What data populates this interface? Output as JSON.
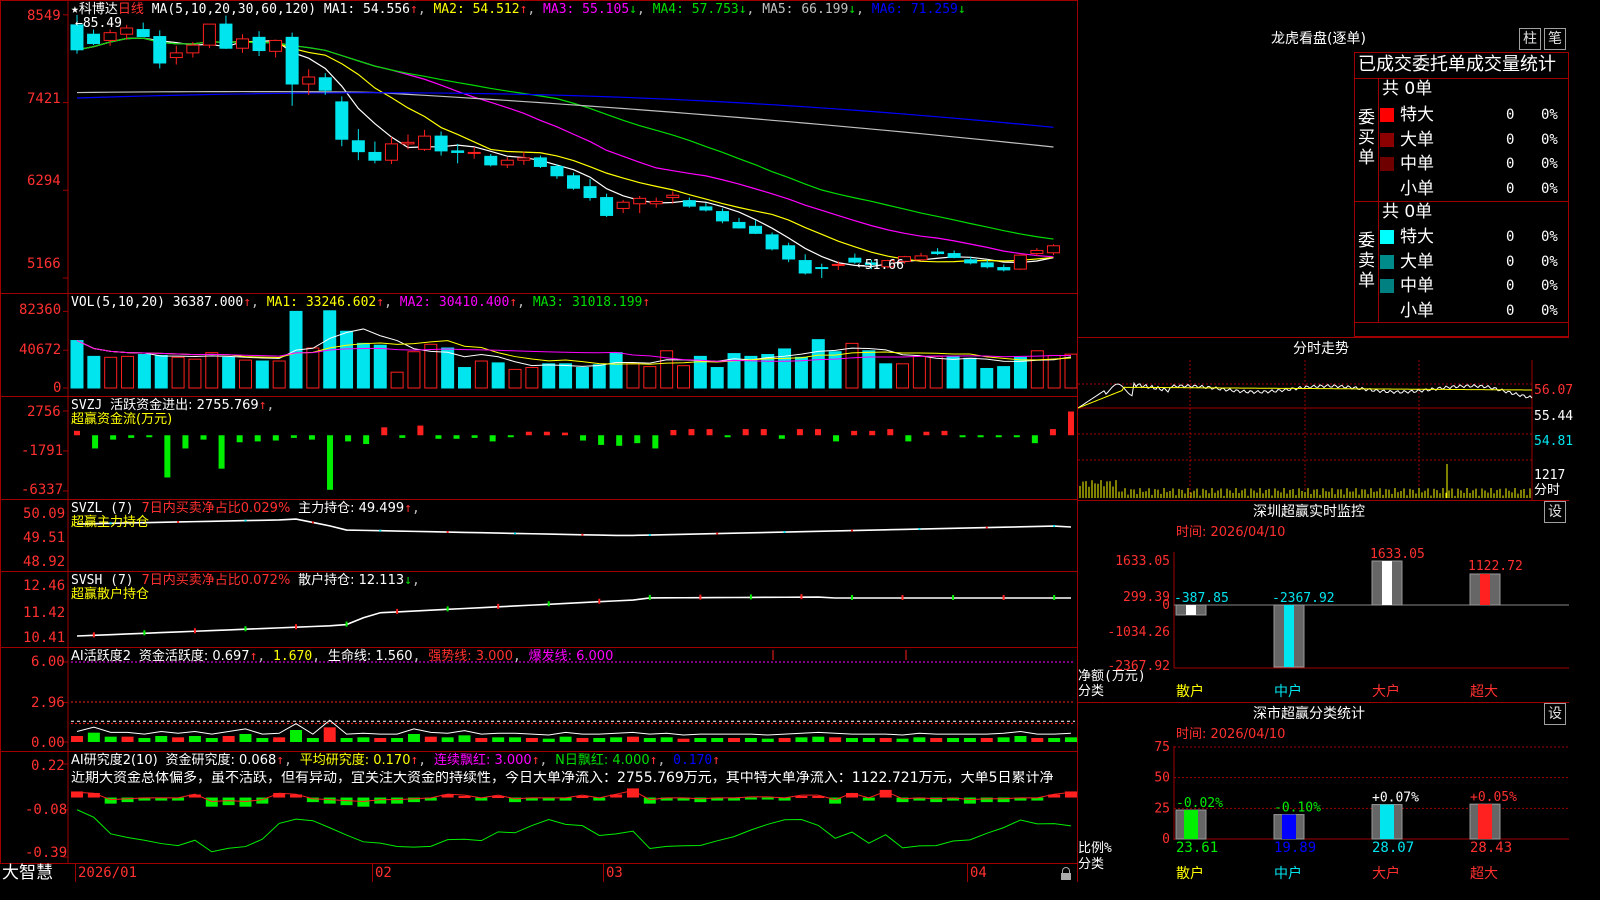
{
  "colors": {
    "up": "#ff2020",
    "down": "#00e5ee",
    "bg": "#000000",
    "grid": "#a00000",
    "axisText": "#ff3030",
    "ma1": "#ffffff",
    "ma2": "#ffff00",
    "ma3": "#ff00ff",
    "ma4": "#00dd00",
    "ma5": "#c0c0c0",
    "ma6": "#0000ff",
    "zoom": "#ffff00"
  },
  "main": {
    "header": {
      "star": "★",
      "name": "科博达",
      "period": "日线",
      "ma_label": "MA(5,10,20,30,60,120)",
      "ma1": "MA1: 54.556",
      "ma2": "MA2: 54.512",
      "ma3": "MA3: 55.105",
      "ma4": "MA4: 57.753",
      "ma5": "MA5: 66.199",
      "ma6": "MA6: 71.259",
      "ma1_arrow": "↑",
      "ma2_arrow": "↑",
      "ma3_arrow": "↓",
      "ma4_arrow": "↓",
      "ma5_arrow": "↓",
      "ma6_arrow": "↓"
    },
    "yticks": [
      {
        "label": "8549",
        "v": 85.49
      },
      {
        "label": "7421",
        "v": 74.21
      },
      {
        "label": "6294",
        "v": 62.94
      },
      {
        "label": "5166",
        "v": 51.66
      }
    ],
    "high_label": "←85.49",
    "low_label": "←51.66"
  },
  "chart_data": [
    {
      "type": "candlestick",
      "name": "科博达 日线",
      "x_labels": [
        "2026/01",
        "02",
        "03",
        "04"
      ],
      "ylim": [
        50.5,
        86.5
      ],
      "ohlc": [
        [
          84.2,
          85.49,
          80.5,
          81.0
        ],
        [
          83.0,
          83.6,
          81.6,
          81.8
        ],
        [
          82.2,
          83.6,
          81.5,
          83.2
        ],
        [
          83.0,
          84.2,
          82.3,
          83.8
        ],
        [
          83.6,
          84.5,
          82.8,
          82.7
        ],
        [
          82.7,
          83.5,
          78.6,
          79.3
        ],
        [
          80.0,
          81.5,
          79.1,
          80.6
        ],
        [
          80.6,
          82.0,
          80.0,
          81.6
        ],
        [
          81.6,
          83.8,
          81.2,
          84.3
        ],
        [
          84.3,
          85.4,
          81.1,
          81.2
        ],
        [
          81.2,
          83.0,
          80.6,
          82.4
        ],
        [
          82.6,
          83.4,
          80.2,
          80.9
        ],
        [
          80.8,
          82.3,
          80.0,
          82.2
        ],
        [
          82.6,
          83.2,
          73.8,
          76.6
        ],
        [
          76.6,
          78.5,
          75.2,
          77.5
        ],
        [
          77.4,
          78.0,
          75.2,
          75.8
        ],
        [
          74.3,
          75.0,
          68.6,
          69.5
        ],
        [
          69.3,
          70.8,
          66.8,
          67.9
        ],
        [
          67.8,
          69.2,
          66.4,
          66.8
        ],
        [
          66.8,
          69.8,
          66.3,
          68.9
        ],
        [
          68.9,
          70.1,
          68.2,
          69.1
        ],
        [
          68.2,
          70.7,
          68.0,
          69.9
        ],
        [
          69.9,
          70.5,
          67.4,
          68.0
        ],
        [
          68.0,
          68.9,
          66.4,
          67.8
        ],
        [
          67.8,
          68.5,
          67.0,
          67.8
        ],
        [
          67.3,
          67.6,
          66.0,
          66.2
        ],
        [
          66.2,
          67.2,
          65.8,
          66.8
        ],
        [
          66.8,
          67.9,
          66.2,
          67.1
        ],
        [
          67.1,
          67.4,
          65.8,
          66.0
        ],
        [
          66.0,
          66.3,
          64.4,
          64.8
        ],
        [
          64.8,
          65.2,
          63.0,
          63.2
        ],
        [
          63.4,
          64.4,
          61.6,
          62.0
        ],
        [
          62.0,
          62.5,
          59.5,
          59.7
        ],
        [
          60.6,
          61.7,
          60.0,
          61.4
        ],
        [
          61.2,
          62.2,
          60.0,
          61.9
        ],
        [
          61.2,
          62.0,
          60.7,
          61.5
        ],
        [
          62.0,
          62.8,
          61.2,
          62.3
        ],
        [
          61.6,
          62.0,
          60.7,
          60.9
        ],
        [
          60.8,
          61.3,
          60.2,
          60.4
        ],
        [
          60.2,
          60.6,
          58.7,
          59.0
        ],
        [
          58.8,
          59.4,
          58.0,
          58.1
        ],
        [
          58.3,
          59.1,
          57.3,
          57.4
        ],
        [
          57.2,
          57.5,
          55.2,
          55.4
        ],
        [
          55.8,
          56.2,
          53.7,
          54.1
        ],
        [
          53.9,
          54.7,
          52.1,
          52.3
        ],
        [
          53.0,
          53.5,
          51.66,
          52.9
        ],
        [
          53.3,
          53.8,
          52.7,
          53.4
        ],
        [
          54.2,
          54.8,
          53.5,
          53.7
        ],
        [
          53.6,
          54.0,
          52.8,
          53.4
        ],
        [
          53.1,
          54.0,
          52.9,
          53.9
        ],
        [
          53.8,
          54.5,
          53.5,
          54.4
        ],
        [
          54.0,
          54.9,
          53.9,
          54.5
        ],
        [
          55.0,
          55.5,
          54.6,
          54.8
        ],
        [
          54.8,
          55.2,
          54.2,
          54.3
        ],
        [
          54.0,
          54.4,
          53.4,
          53.6
        ],
        [
          53.6,
          54.0,
          52.9,
          53.1
        ],
        [
          53.0,
          53.4,
          52.5,
          52.7
        ],
        [
          52.8,
          54.7,
          52.7,
          54.6
        ],
        [
          54.8,
          55.5,
          54.5,
          55.2
        ],
        [
          54.9,
          56.0,
          54.6,
          55.8
        ]
      ],
      "series": [
        {
          "name": "MA1",
          "last": 54.556
        },
        {
          "name": "MA2",
          "last": 54.512
        },
        {
          "name": "MA3",
          "last": 55.105
        },
        {
          "name": "MA4",
          "last": 57.753
        },
        {
          "name": "MA5",
          "last": 66.199
        },
        {
          "name": "MA6",
          "last": 71.259
        }
      ]
    },
    {
      "type": "bar",
      "name": "VOL(5,10,20)",
      "ylim": [
        0,
        86000
      ],
      "yticks": [
        "82360",
        "40672",
        "0"
      ],
      "values": [
        51000,
        34000,
        33000,
        34000,
        36000,
        35000,
        33000,
        31000,
        38000,
        33000,
        30000,
        29000,
        29000,
        82360,
        43000,
        83000,
        61000,
        48000,
        46000,
        17000,
        39000,
        47000,
        43000,
        22000,
        29000,
        27000,
        20000,
        22000,
        26000,
        26000,
        22000,
        25000,
        38000,
        26000,
        23000,
        40000,
        24000,
        34000,
        22000,
        37000,
        34000,
        36000,
        42000,
        33000,
        52000,
        39000,
        48000,
        40000,
        26000,
        26000,
        34000,
        34000,
        34000,
        32000,
        21000,
        23000,
        33000,
        40000,
        35000,
        36387
      ]
    },
    {
      "type": "bar",
      "name": "超赢资金流(万元)",
      "ylim": [
        -6337,
        2756
      ],
      "yticks": [
        "2756",
        "-1791",
        "-6337"
      ],
      "values": [
        500,
        -1500,
        -500,
        -300,
        -200,
        -4800,
        -1500,
        -500,
        -3800,
        -800,
        -700,
        -600,
        -300,
        -500,
        -6200,
        -700,
        -1000,
        900,
        -300,
        1100,
        -400,
        -400,
        -300,
        -700,
        -100,
        400,
        400,
        300,
        -600,
        -1100,
        -1200,
        -900,
        -1500,
        600,
        700,
        700,
        -100,
        700,
        700,
        -400,
        700,
        700,
        -700,
        500,
        500,
        700,
        -700,
        400,
        500,
        -100,
        -100,
        -100,
        -100,
        -900,
        700,
        2700
      ]
    },
    {
      "type": "line",
      "name": "超赢主力持仓",
      "ylim": [
        48.92,
        50.09
      ],
      "yticks": [
        "50.09",
        "49.51",
        "48.92"
      ],
      "last": 49.499
    },
    {
      "type": "line",
      "name": "超赢散户持仓",
      "ylim": [
        10.41,
        12.46
      ],
      "yticks": [
        "12.46",
        "11.42",
        "10.41"
      ],
      "last": 12.113
    },
    {
      "type": "bar",
      "name": "AI活跃度2",
      "ylim": [
        0,
        6
      ],
      "yticks": [
        "6.00",
        "2.96",
        "0.00"
      ],
      "values": [
        0.45,
        0.7,
        0.4,
        0.4,
        0.3,
        0.45,
        0.35,
        0.45,
        0.3,
        0.45,
        0.6,
        0.3,
        0.35,
        0.9,
        0.3,
        1.1,
        0.3,
        0.35,
        0.3,
        0.3,
        0.6,
        0.4,
        0.35,
        0.5,
        0.3,
        0.35,
        0.35,
        0.3,
        0.25,
        0.4,
        0.3,
        0.3,
        0.35,
        0.4,
        0.3,
        0.35,
        0.25,
        0.3,
        0.3,
        0.3,
        0.3,
        0.25,
        0.3,
        0.35,
        0.4,
        0.35,
        0.3,
        0.3,
        0.3,
        0.25,
        0.35,
        0.3,
        0.3,
        0.3,
        0.3,
        0.35,
        0.45,
        0.3,
        0.3,
        0.35
      ]
    },
    {
      "type": "bar",
      "name": "AI研究度2(10)",
      "ylim": [
        -0.39,
        0.22
      ],
      "yticks": [
        "0.22",
        "-0.08",
        "-0.39"
      ],
      "values": [
        0.04,
        0.03,
        -0.04,
        -0.03,
        -0.02,
        -0.02,
        -0.02,
        0.02,
        -0.06,
        -0.05,
        -0.06,
        -0.04,
        0.03,
        0.02,
        -0.03,
        -0.04,
        -0.05,
        -0.06,
        -0.04,
        -0.04,
        -0.03,
        -0.02,
        0.02,
        0.01,
        -0.02,
        0.01,
        -0.03,
        -0.02,
        -0.02,
        -0.02,
        0.01,
        -0.02,
        0.02,
        0.06,
        -0.04,
        -0.02,
        -0.02,
        -0.03,
        -0.02,
        -0.02,
        -0.01,
        -0.01,
        -0.02,
        0.01,
        0.01,
        -0.04,
        0.03,
        -0.02,
        0.05,
        -0.03,
        -0.02,
        -0.03,
        -0.02,
        -0.04,
        -0.03,
        -0.03,
        -0.02,
        -0.02,
        0.02,
        0.04
      ]
    },
    {
      "type": "line",
      "name": "分时走势",
      "yticks": [
        "56.07",
        "55.44",
        "54.81"
      ],
      "vol_label": "1217",
      "vol_unit": "分时"
    },
    {
      "type": "bar",
      "name": "深圳超赢实时监控",
      "categories": [
        "散户",
        "中户",
        "大户",
        "超大"
      ],
      "values": [
        -387.85,
        -2367.92,
        1633.05,
        1122.72
      ],
      "yticks": [
        "1633.05",
        "299.39",
        "0",
        "-1034.26",
        "-2367.92"
      ],
      "ylabel": "净额(万元)",
      "xlabel": "分类"
    },
    {
      "type": "bar",
      "name": "深市超赢分类统计",
      "categories": [
        "散户",
        "中户",
        "大户",
        "超大"
      ],
      "values": [
        23.61,
        19.89,
        28.07,
        28.43
      ],
      "changes": [
        "-0.02%",
        "-0.10%",
        "+0.07%",
        "+0.05%"
      ],
      "yticks": [
        "75",
        "50",
        "25",
        "0"
      ],
      "ylabel": "比例%",
      "xlabel": "分类"
    }
  ],
  "vol": {
    "label": "VOL(5,10,20)",
    "value": "36387.000",
    "ma1": "MA1: 33246.602",
    "ma2": "MA2: 30410.400",
    "ma3": "MA3: 31018.199",
    "a0": "↑",
    "a1": "↑",
    "a2": "↑",
    "a3": "↑"
  },
  "svzj": {
    "label": "SVZJ",
    "title": "活跃资金进出: 2755.769",
    "arrow": "↑",
    "sub": "超赢资金流(万元)"
  },
  "svzl": {
    "label": "SVZL (7)",
    "ratio": "7日内买卖净占比0.029%",
    "hold": "主力持仓: 49.499",
    "arrow": "↑",
    "sub": "超赢主力持仓"
  },
  "svsh": {
    "label": "SVSH (7)",
    "ratio": "7日内买卖净占比0.072%",
    "hold": "散户持仓: 12.113",
    "arrow": "↓",
    "sub": "超赢散户持仓"
  },
  "ai1": {
    "label": "AI活跃度2",
    "a": "资金活跃度: 0.697",
    "b": "1.670",
    "c": "生命线: 1.560",
    "d": "强势线: 3.000",
    "e": "爆发线: 6.000"
  },
  "ai2": {
    "label": "AI研究度2(10)",
    "a": "资金研究度: 0.068",
    "b": "平均研究度: 0.170",
    "c": "连续飘红: 3.000",
    "d": "N日飘红: 4.000",
    "e": "0.170",
    "ticker": "近期大资金总体偏多，虽不活跃，但有异动，宜关注大资金的持续性，今日大单净流入：2755.769万元，其中特大单净流入：1122.721万元，大单5日累计净"
  },
  "bottom": {
    "logo": "大智慧"
  },
  "right": {
    "lhkp_title": "龙虎看盘(逐单)",
    "btn_zhu": "柱",
    "btn_bi": "笔",
    "stat_title": "已成交委托单成交量统计",
    "buy": {
      "total": "共 0单",
      "side": "委买单",
      "rows": [
        {
          "name": "特大",
          "count": "0",
          "pct": "0%",
          "color": "#ff0000"
        },
        {
          "name": "大单",
          "count": "0",
          "pct": "0%",
          "color": "#8b0000"
        },
        {
          "name": "中单",
          "count": "0",
          "pct": "0%",
          "color": "#6e0000"
        },
        {
          "name": "小单",
          "count": "0",
          "pct": "0%",
          "color": "#000000"
        }
      ]
    },
    "sell": {
      "total": "共 0单",
      "side": "委卖单",
      "rows": [
        {
          "name": "特大",
          "count": "0",
          "pct": "0%",
          "color": "#00ffff"
        },
        {
          "name": "大单",
          "count": "0",
          "pct": "0%",
          "color": "#008b8b"
        },
        {
          "name": "中单",
          "count": "0",
          "pct": "0%",
          "color": "#008080"
        },
        {
          "name": "小单",
          "count": "0",
          "pct": "0%",
          "color": "#000000"
        }
      ]
    },
    "fs_title": "分时走势",
    "fs_p1": "56.07",
    "fs_p2": "55.44",
    "fs_p3": "54.81",
    "fs_v": "1217",
    "fs_vu": "分时",
    "mon_title": "深圳超赢实时监控",
    "mon_date": "时间: 2026/04/10",
    "set": "设",
    "mon_vals": [
      "-387.85",
      "-2367.92",
      "1633.05",
      "1122.72"
    ],
    "mon_yt": [
      "1633.05",
      "299.39",
      "0",
      "-1034.26",
      "-2367.92"
    ],
    "mon_ylabel": "净额(万元)",
    "mon_xlabel": "分类",
    "cats": [
      "散户",
      "中户",
      "大户",
      "超大"
    ],
    "cls_title": "深市超赢分类统计",
    "cls_date": "时间: 2026/04/10",
    "cls_yt": [
      "75",
      "50",
      "25",
      "0"
    ],
    "cls_vals": [
      "23.61",
      "19.89",
      "28.07",
      "28.43"
    ],
    "cls_chg": [
      "-0.02%",
      "-0.10%",
      "+0.07%",
      "+0.05%"
    ],
    "cls_ylabel": "比例%",
    "cls_xlabel": "分类"
  }
}
